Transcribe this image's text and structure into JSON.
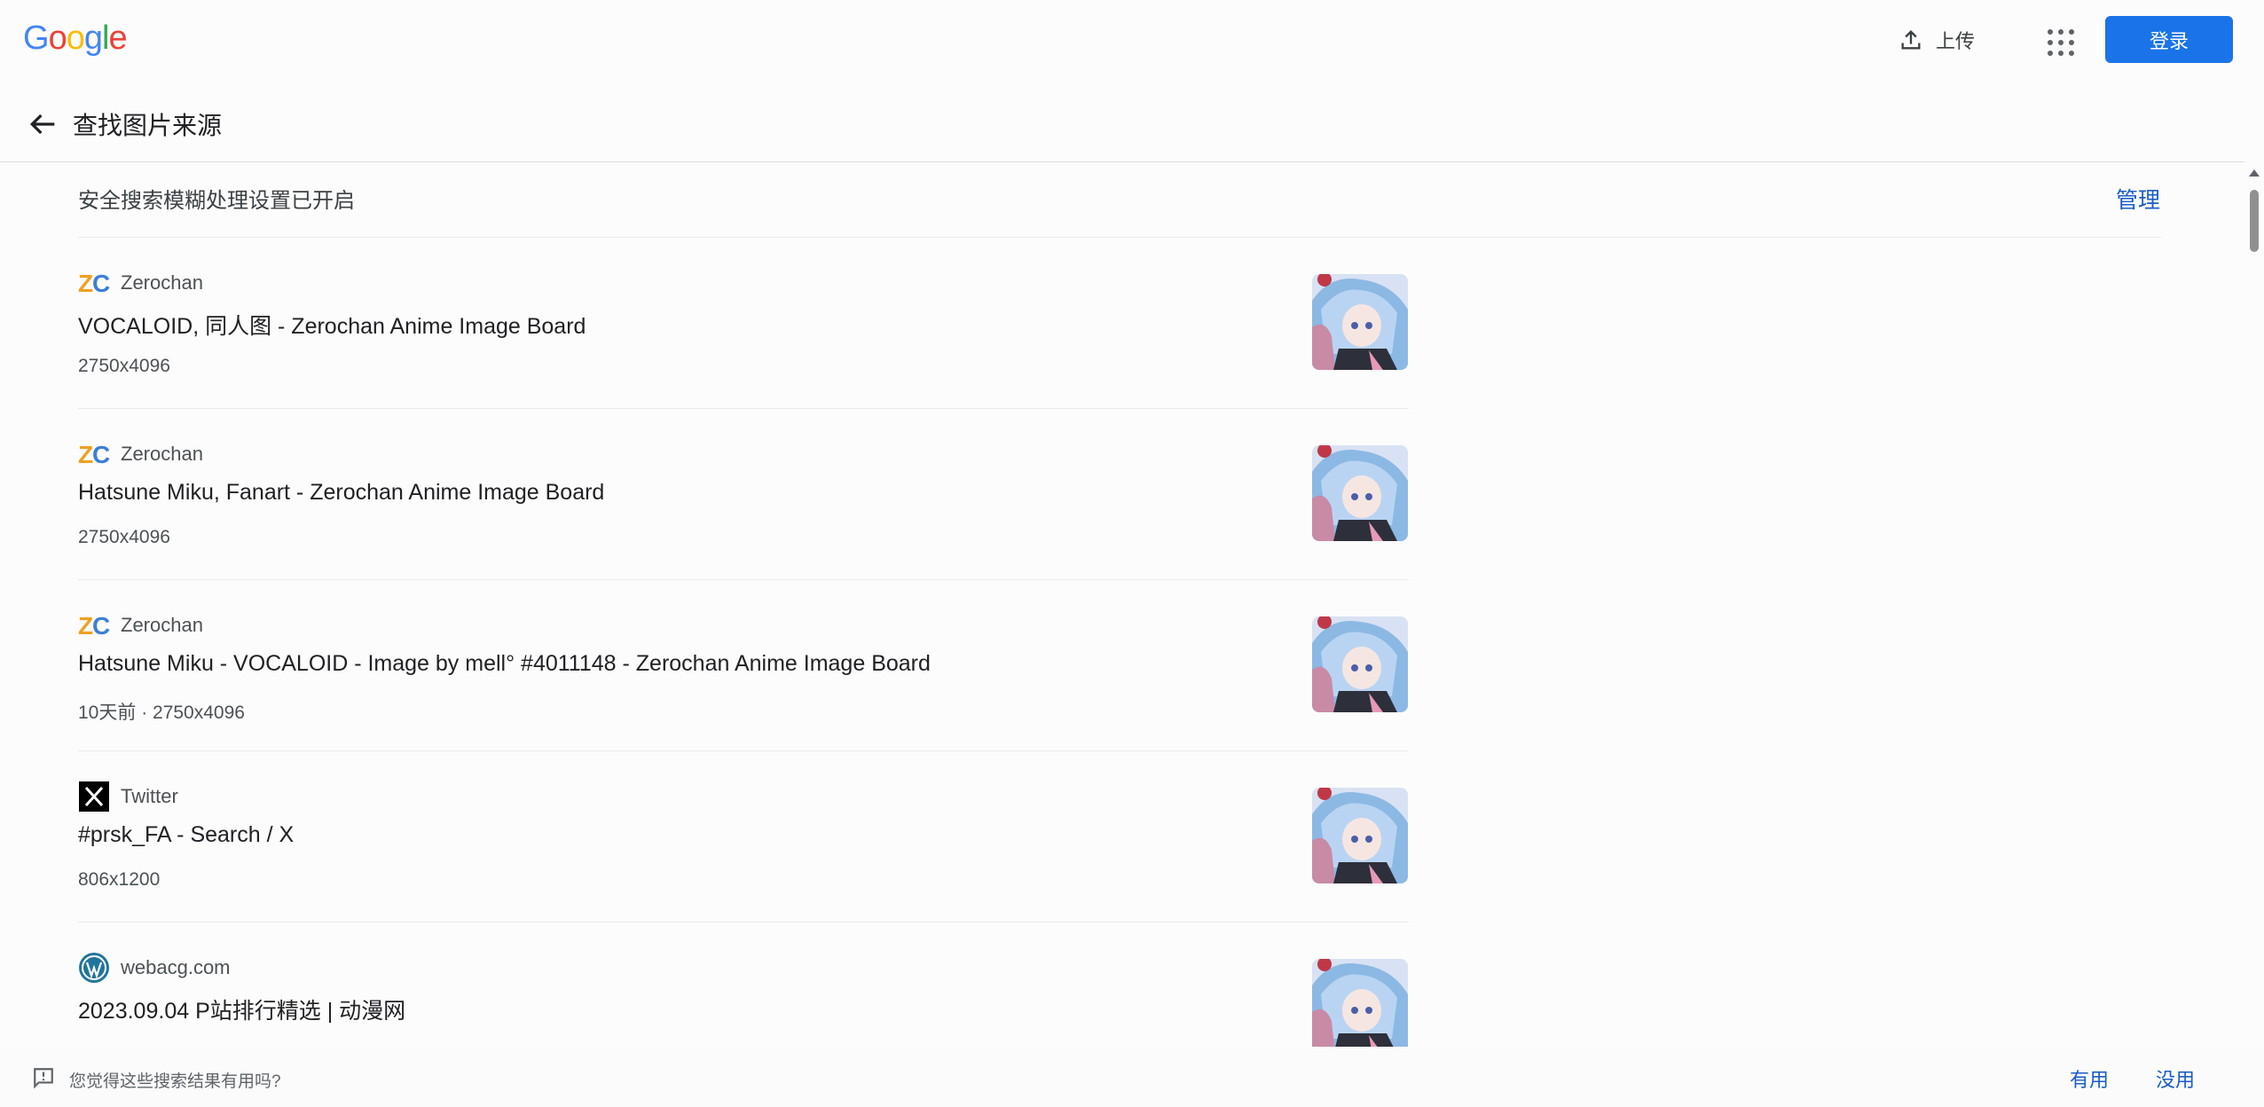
{
  "brand": {
    "letters": [
      "G",
      "o",
      "o",
      "g",
      "l",
      "e"
    ],
    "colors": [
      "#4285F4",
      "#EA4335",
      "#FBBC05",
      "#4285F4",
      "#34A853",
      "#EA4335"
    ]
  },
  "header": {
    "upload_label": "上传",
    "apps_icon": "apps-grid-icon",
    "signin_label": "登录",
    "accent": "#1a73e8"
  },
  "subheader": {
    "back_icon": "arrow-left-icon",
    "title": "查找图片来源"
  },
  "safesearch": {
    "text": "安全搜索模糊处理设置已开启",
    "manage_label": "管理"
  },
  "results": [
    {
      "source": "Zerochan",
      "favicon": "zerochan-icon",
      "title": "VOCALOID, 同人图 - Zerochan Anime Image Board",
      "meta": "2750x4096",
      "thumb_icon": "anime-thumbnail"
    },
    {
      "source": "Zerochan",
      "favicon": "zerochan-icon",
      "title": "Hatsune Miku, Fanart - Zerochan Anime Image Board",
      "meta": "2750x4096",
      "thumb_icon": "anime-thumbnail"
    },
    {
      "source": "Zerochan",
      "favicon": "zerochan-icon",
      "title": "Hatsune Miku - VOCALOID - Image by mell° #4011148 - Zerochan Anime Image Board",
      "meta": "10天前 · 2750x4096",
      "thumb_icon": "anime-thumbnail"
    },
    {
      "source": "Twitter",
      "favicon": "x-icon",
      "title": "#prsk_FA - Search / X",
      "meta": "806x1200",
      "thumb_icon": "anime-thumbnail"
    },
    {
      "source": "webacg.com",
      "favicon": "wordpress-icon",
      "title": "2023.09.04 P站排行精选 | 动漫网",
      "meta": "",
      "thumb_icon": "anime-thumbnail"
    }
  ],
  "footer": {
    "feedback_icon": "feedback-icon",
    "question": "您觉得这些搜索结果有用吗?",
    "useful": "有用",
    "useless": "没用"
  }
}
